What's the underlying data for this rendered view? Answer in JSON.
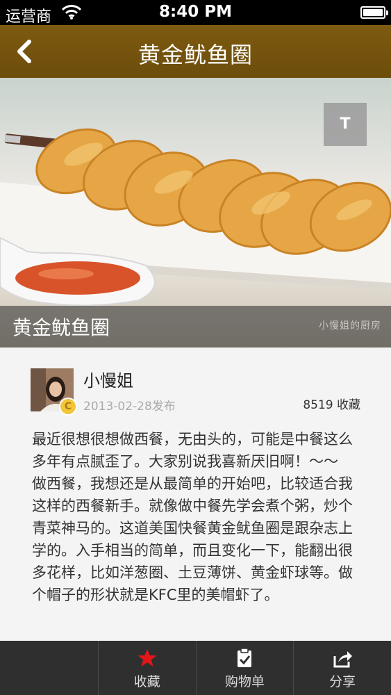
{
  "status_bar": {
    "carrier": "运营商",
    "time": "8:40 PM"
  },
  "nav": {
    "title": "黄金鱿鱼圈",
    "back_icon": "chevron-left-icon"
  },
  "hero": {
    "caption": "黄金鱿鱼圈",
    "watermark": "小慢姐的厨房",
    "text_button_label": "T"
  },
  "author": {
    "name": "小慢姐",
    "badge": "C",
    "publish_date": "2013-02-28发布",
    "favorites": "8519 收藏"
  },
  "description": "最近很想很想做西餐，无由头的，可能是中餐这么多年有点腻歪了。大家别说我喜新厌旧啊！～～\n做西餐，我想还是从最简单的开始吧，比较适合我这样的西餐新手。就像做中餐先学会煮个粥，炒个青菜神马的。这道美国快餐黄金鱿鱼圈是跟杂志上学的。入手相当的简单，而且变化一下，能翻出很多花样，比如洋葱圈、土豆薄饼、黄金虾球等。做个帽子的形状就是KFC里的美帽虾了。",
  "tabs": [
    {
      "label": "",
      "icon": ""
    },
    {
      "label": "收藏",
      "icon": "star-icon"
    },
    {
      "label": "购物单",
      "icon": "checklist-icon"
    },
    {
      "label": "分享",
      "icon": "share-icon"
    }
  ],
  "colors": {
    "nav_bar": "#6c4d0b",
    "tab_bar": "#2f2f2f",
    "star": "#e3161a"
  }
}
